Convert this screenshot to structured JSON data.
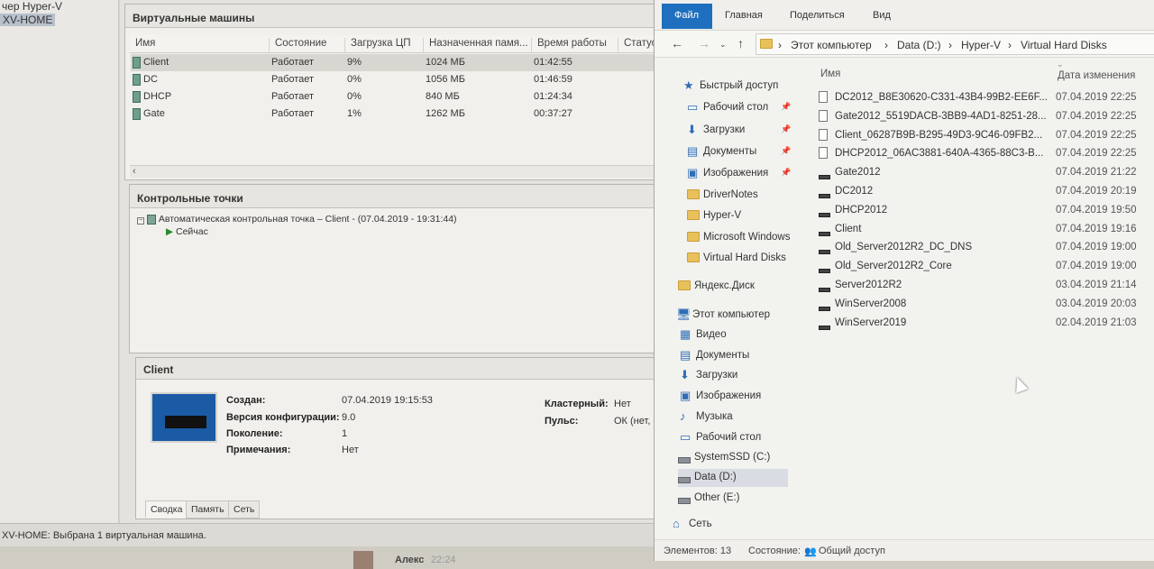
{
  "left_tree": {
    "items": [
      {
        "label": "чер Hyper-V"
      },
      {
        "label": "XV-HOME"
      }
    ]
  },
  "vms_panel": {
    "title": "Виртуальные машины",
    "columns": [
      "Имя",
      "Состояние",
      "Загрузка ЦП",
      "Назначенная памя...",
      "Время работы",
      "Статус"
    ],
    "rows": [
      {
        "name": "Client",
        "state": "Работает",
        "cpu": "9%",
        "mem": "1024 МБ",
        "uptime": "01:42:55"
      },
      {
        "name": "DC",
        "state": "Работает",
        "cpu": "0%",
        "mem": "1056 МБ",
        "uptime": "01:46:59"
      },
      {
        "name": "DHCP",
        "state": "Работает",
        "cpu": "0%",
        "mem": "840 МБ",
        "uptime": "01:24:34"
      },
      {
        "name": "Gate",
        "state": "Работает",
        "cpu": "1%",
        "mem": "1262 МБ",
        "uptime": "00:37:27"
      }
    ]
  },
  "checkpoints": {
    "title": "Контрольные точки",
    "item": "Автоматическая контрольная точка – Client - (07.04.2019 - 19:31:44)",
    "now": "Сейчас"
  },
  "details": {
    "title": "Client",
    "created_label": "Создан:",
    "created": "07.04.2019 19:15:53",
    "config_label": "Версия конфигурации:",
    "config": "9.0",
    "gen_label": "Поколение:",
    "gen": "1",
    "notes_label": "Примечания:",
    "notes": "Нет",
    "cluster_label": "Кластерный:",
    "cluster": "Нет",
    "pulse_label": "Пульс:",
    "pulse": "ОК (нет, ...",
    "tabs": [
      "Сводка",
      "Память",
      "Сеть"
    ]
  },
  "status_bar": "XV-HOME: Выбрана 1 виртуальная машина.",
  "chat": {
    "name": "Алекс",
    "time": "22:24"
  },
  "explorer": {
    "ribbon": [
      "Файл",
      "Главная",
      "Поделиться",
      "Вид"
    ],
    "path": [
      "Этот компьютер",
      "Data (D:)",
      "Hyper-V",
      "Virtual Hard Disks"
    ],
    "nav": [
      {
        "label": "Быстрый доступ",
        "icon": "star-icon"
      },
      {
        "label": "Рабочий стол",
        "icon": "desktop-icon",
        "pinned": true
      },
      {
        "label": "Загрузки",
        "icon": "download-icon",
        "pinned": true
      },
      {
        "label": "Документы",
        "icon": "document-icon",
        "pinned": true
      },
      {
        "label": "Изображения",
        "icon": "pictures-icon",
        "pinned": true
      },
      {
        "label": "DriverNotes",
        "icon": "folder-icon"
      },
      {
        "label": "Hyper-V",
        "icon": "folder-icon"
      },
      {
        "label": "Microsoft Windows",
        "icon": "folder-icon"
      },
      {
        "label": "Virtual Hard Disks",
        "icon": "folder-icon"
      },
      {
        "label": "Яндекс.Диск",
        "icon": "folder-icon"
      },
      {
        "label": "Этот компьютер",
        "icon": "computer-icon"
      },
      {
        "label": "Видео",
        "icon": "video-icon"
      },
      {
        "label": "Документы",
        "icon": "document-icon"
      },
      {
        "label": "Загрузки",
        "icon": "download-icon"
      },
      {
        "label": "Изображения",
        "icon": "pictures-icon"
      },
      {
        "label": "Музыка",
        "icon": "music-icon"
      },
      {
        "label": "Рабочий стол",
        "icon": "desktop-icon"
      },
      {
        "label": "SystemSSD (C:)",
        "icon": "drive-icon"
      },
      {
        "label": "Data (D:)",
        "icon": "drive-icon",
        "selected": true
      },
      {
        "label": "Other (E:)",
        "icon": "drive-icon"
      },
      {
        "label": "Сеть",
        "icon": "network-icon"
      }
    ],
    "col_name": "Имя",
    "col_date": "Дата изменения",
    "files": [
      {
        "name": "DC2012_B8E30620-C331-43B4-99B2-EE6F...",
        "date": "07.04.2019 22:25",
        "type": "file"
      },
      {
        "name": "Gate2012_5519DACB-3BB9-4AD1-8251-28...",
        "date": "07.04.2019 22:25",
        "type": "file"
      },
      {
        "name": "Client_06287B9B-B295-49D3-9C46-09FB2...",
        "date": "07.04.2019 22:25",
        "type": "file"
      },
      {
        "name": "DHCP2012_06AC3881-640A-4365-88C3-B...",
        "date": "07.04.2019 22:25",
        "type": "file"
      },
      {
        "name": "Gate2012",
        "date": "07.04.2019 21:22",
        "type": "vhd"
      },
      {
        "name": "DC2012",
        "date": "07.04.2019 20:19",
        "type": "vhd"
      },
      {
        "name": "DHCP2012",
        "date": "07.04.2019 19:50",
        "type": "vhd"
      },
      {
        "name": "Client",
        "date": "07.04.2019 19:16",
        "type": "vhd"
      },
      {
        "name": "Old_Server2012R2_DC_DNS",
        "date": "07.04.2019 19:00",
        "type": "vhd"
      },
      {
        "name": "Old_Server2012R2_Core",
        "date": "07.04.2019 19:00",
        "type": "vhd"
      },
      {
        "name": "Server2012R2",
        "date": "03.04.2019 21:14",
        "type": "vhd"
      },
      {
        "name": "WinServer2008",
        "date": "03.04.2019 20:03",
        "type": "vhd"
      },
      {
        "name": "WinServer2019",
        "date": "02.04.2019 21:03",
        "type": "vhd"
      }
    ],
    "status_items": "Элементов: 13",
    "status_state": "Состояние:",
    "status_share": "Общий доступ"
  }
}
